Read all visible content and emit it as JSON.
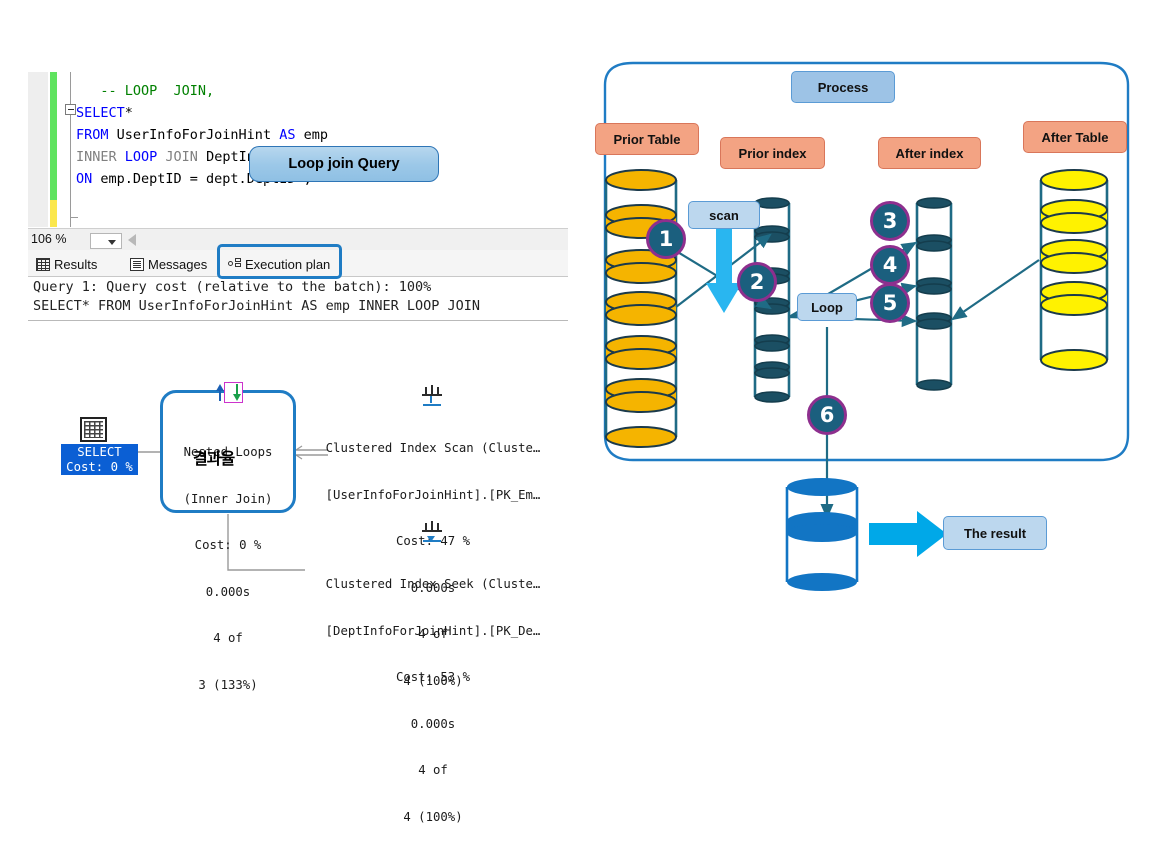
{
  "ssms": {
    "code_lines": [
      {
        "segments": [
          {
            "t": "   -- ",
            "c": "cmt"
          },
          {
            "t": "LOOP  JOIN,",
            "c": "cmt"
          }
        ]
      },
      {
        "segments": [
          {
            "t": "SELECT",
            "c": "kw"
          },
          {
            "t": "*",
            "c": "blk"
          }
        ]
      },
      {
        "segments": [
          {
            "t": "FROM ",
            "c": "kw"
          },
          {
            "t": "UserInfoForJoinHint ",
            "c": "blk"
          },
          {
            "t": "AS ",
            "c": "kw"
          },
          {
            "t": "emp",
            "c": "blk"
          }
        ]
      },
      {
        "segments": [
          {
            "t": "INNER ",
            "c": "gray"
          },
          {
            "t": "LOOP ",
            "c": "kw"
          },
          {
            "t": "JOIN ",
            "c": "gray"
          },
          {
            "t": "DeptInfoForJoinHint ",
            "c": "blk"
          },
          {
            "t": "AS ",
            "c": "kw"
          },
          {
            "t": "dept",
            "c": "blk"
          }
        ]
      },
      {
        "segments": [
          {
            "t": "ON ",
            "c": "kw"
          },
          {
            "t": "emp.DeptID = dept.DeptID ;",
            "c": "blk"
          }
        ]
      }
    ],
    "query_badge": "Loop  join Query",
    "zoom_level": "106 %",
    "tabs": [
      {
        "label": "Results",
        "icon": "grid-icon"
      },
      {
        "label": "Messages",
        "icon": "messages-icon"
      },
      {
        "label": "Execution plan",
        "icon": "execution-plan-icon"
      }
    ],
    "plan_summary_line1": "Query 1: Query cost (relative to the batch): 100%",
    "plan_summary_line2": "SELECT* FROM UserInfoForJoinHint AS emp INNER LOOP JOIN",
    "plan": {
      "select_node": {
        "title": "SELECT",
        "cost": "Cost: 0 %"
      },
      "nested_loops": {
        "line1": "Nested Loops",
        "line2": "(Inner Join)",
        "line3": "Cost: 0 %",
        "line4": "0.000s",
        "line5": "4 of",
        "line6": "3 (133%)",
        "overlay_korean": "결과율"
      },
      "clustered_index_scan": {
        "line1": "Clustered Index Scan (Cluste…",
        "line2": "[UserInfoForJoinHint].[PK_Em…",
        "line3": "Cost: 47 %",
        "line4": "0.000s",
        "line5": "4 of",
        "line6": "4 (100%)"
      },
      "clustered_index_seek": {
        "line1": "Clustered Index Seek (Cluste…",
        "line2": "[DeptInfoForJoinHint].[PK_De…",
        "line3": "Cost: 53 %",
        "line4": "0.000s",
        "line5": "4 of",
        "line6": "4 (100%)"
      }
    }
  },
  "diagram": {
    "process_label": "Process",
    "prior_table_label": "Prior Table",
    "prior_index_label": "Prior index",
    "after_index_label": "After index",
    "after_table_label": "After Table",
    "scan_label": "scan",
    "loop_label": "Loop",
    "result_label": "The result",
    "steps": [
      "1",
      "2",
      "3",
      "4",
      "5",
      "6"
    ],
    "colors": {
      "prior_disc": "#f5b400",
      "after_disc": "#fff200",
      "index_disc": "#1b4f63",
      "result_disc": "#1275c4",
      "circle_fill": "#1b5f7e",
      "circle_ring": "#8e2f8e",
      "panel_border": "#1f7cc4",
      "arrow_cyan": "#29b6f0",
      "label_orange": "#f3a383",
      "label_blue": "#9dc3e6"
    }
  }
}
